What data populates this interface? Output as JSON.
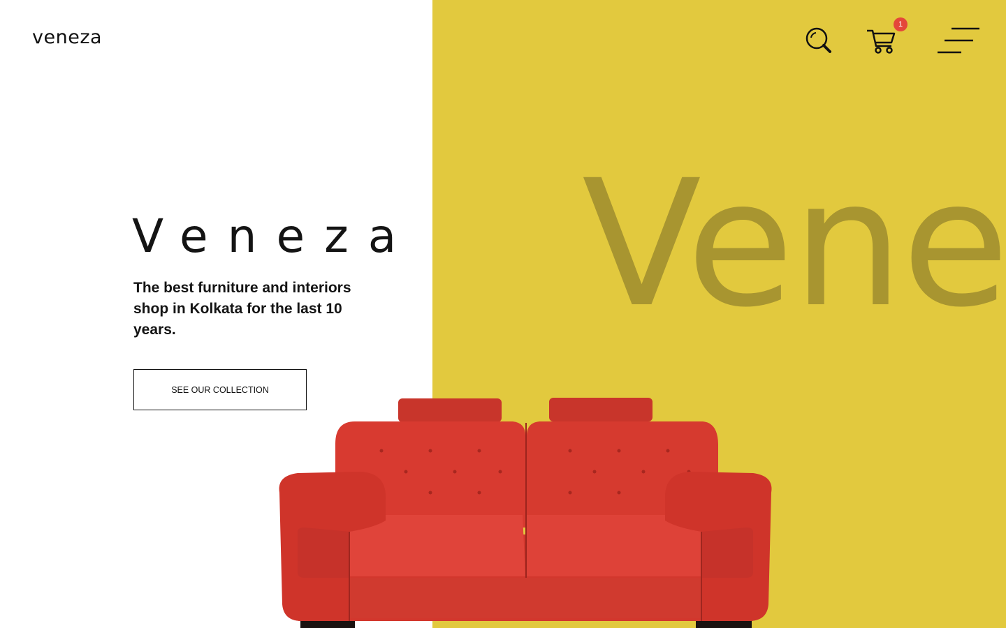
{
  "brand": {
    "logo_text": "veneza",
    "background_word": "Veneza"
  },
  "header": {
    "cart_count": "1",
    "icons": [
      "search-icon",
      "cart-icon",
      "menu-icon"
    ]
  },
  "hero": {
    "title": "Veneza",
    "description": "The best furniture and interiors shop in Kolkata for the last 10 years.",
    "cta_label": "SEE OUR COLLECTION"
  },
  "colors": {
    "accent_yellow": "#e2c93e",
    "sofa_red": "#d83a30",
    "badge_red": "#e4473a"
  }
}
